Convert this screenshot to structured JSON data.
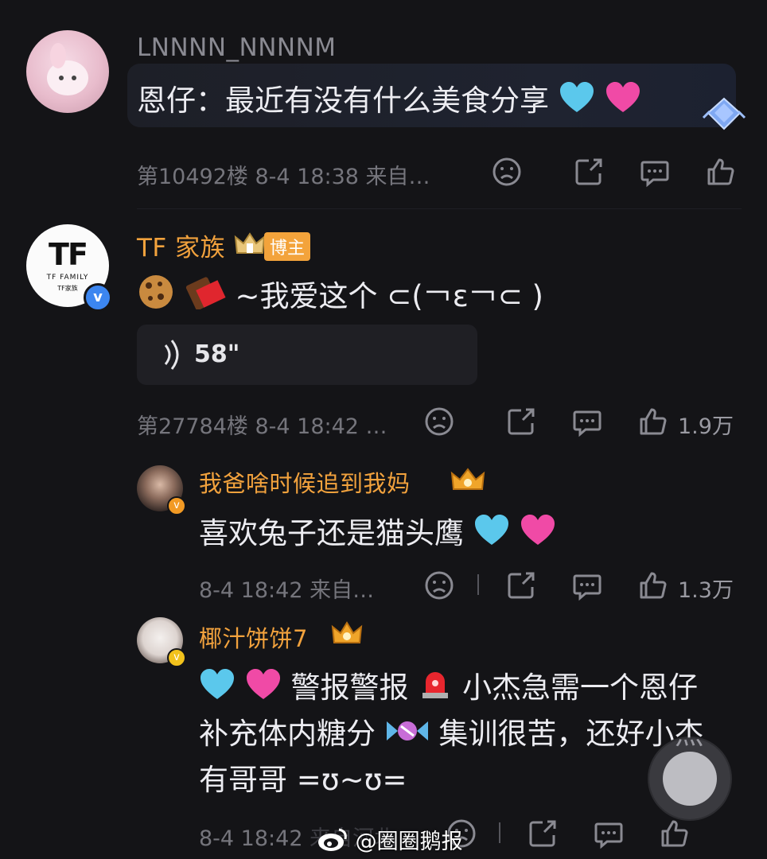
{
  "comments": [
    {
      "username": "LNNNN_NNNNM",
      "text": "恩仔：最近有没有什么美食分享",
      "meta": "第10492楼 8-4 18:38 来自…"
    },
    {
      "username": "TF 家族",
      "badge": "博主",
      "avatar_text_1": "TF",
      "avatar_text_2": "TF FAMILY",
      "avatar_text_3": "TF家族",
      "text": "~我爱这个 ⊂(￢ε￢⊂ )",
      "voice_duration": "58\"",
      "meta": "第27784楼 8-4 18:42 …",
      "likes": "1.9万"
    }
  ],
  "replies": [
    {
      "username": "我爸啥时候追到我妈",
      "text": "喜欢兔子还是猫头鹰",
      "meta": "8-4 18:42 来自…",
      "likes": "1.3万"
    },
    {
      "username": "椰汁饼饼7",
      "line1": "警报警报",
      "line1b": "小杰急需一个恩仔",
      "line2a": "补充体内糖分",
      "line2b": "集训很苦，还好小杰",
      "line3": "有哥哥 =ʊ~ʊ=",
      "meta": "8-4 18:42",
      "meta_partial": "来自河北"
    }
  ],
  "watermark": "@圈圈鹅报",
  "colors": {
    "background": "#141417",
    "username_orange": "#f2a23d",
    "heart_blue": "#5bc8ec",
    "heart_pink": "#f04aa6"
  }
}
